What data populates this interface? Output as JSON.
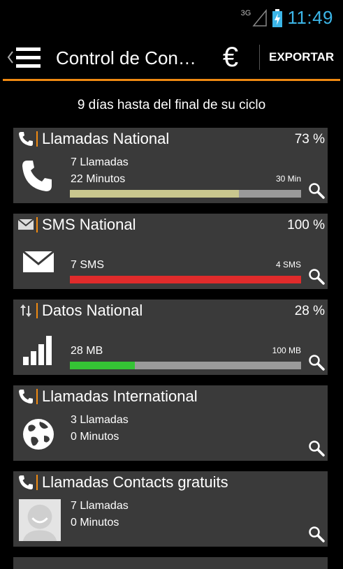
{
  "status": {
    "network": "3G",
    "time": "11:49"
  },
  "actionbar": {
    "title": "Control de Con…",
    "currency_symbol": "€",
    "export_label": "EXPORTAR"
  },
  "cycle_text": "9 días hasta del final de su ciclo",
  "cards": [
    {
      "name": "Llamadas National",
      "percent": "73 %",
      "line1": "7 Llamadas",
      "line2": "22 Minutos",
      "limit": "30 Min",
      "usage_fraction": 0.73,
      "bar_color": "#c9c78e"
    },
    {
      "name": "SMS National",
      "percent": "100 %",
      "line1": "7 SMS",
      "limit": "4 SMS",
      "usage_fraction": 1.0,
      "bar_color": "#e02b2b"
    },
    {
      "name": "Datos National",
      "percent": "28 %",
      "line1": "28 MB",
      "limit": "100 MB",
      "usage_fraction": 0.28,
      "bar_color": "#35c435"
    },
    {
      "name": "Llamadas International",
      "line1": "3 Llamadas",
      "line2": "0 Minutos"
    },
    {
      "name": "Llamadas Contacts gratuits",
      "line1": "7 Llamadas",
      "line2": "0 Minutos"
    }
  ],
  "icons": [
    "phone-icon",
    "envelope-icon",
    "data-arrows-icon",
    "signal-bars-icon",
    "globe-icon",
    "contact-avatar-icon",
    "search-icon",
    "menu-icon",
    "euro-icon",
    "battery-icon"
  ]
}
